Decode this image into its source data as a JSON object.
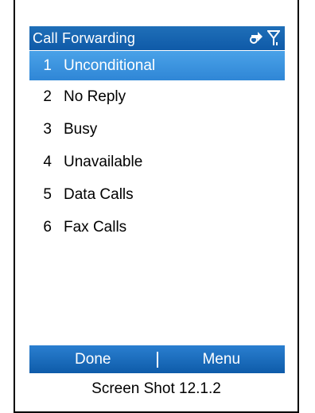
{
  "header": {
    "title": "Call Forwarding",
    "icons": [
      "connection-icon",
      "signal-antenna-icon"
    ]
  },
  "menu": {
    "items": [
      {
        "number": "1",
        "label": "Unconditional",
        "selected": true
      },
      {
        "number": "2",
        "label": "No Reply",
        "selected": false
      },
      {
        "number": "3",
        "label": "Busy",
        "selected": false
      },
      {
        "number": "4",
        "label": "Unavailable",
        "selected": false
      },
      {
        "number": "5",
        "label": "Data Calls",
        "selected": false
      },
      {
        "number": "6",
        "label": "Fax Calls",
        "selected": false
      }
    ]
  },
  "softkeys": {
    "left": "Done",
    "right": "Menu"
  },
  "caption": "Screen Shot 12.1.2",
  "colors": {
    "titlebar": "#1566b3",
    "selection": "#3a93e0",
    "softbar": "#1a6dbf"
  }
}
